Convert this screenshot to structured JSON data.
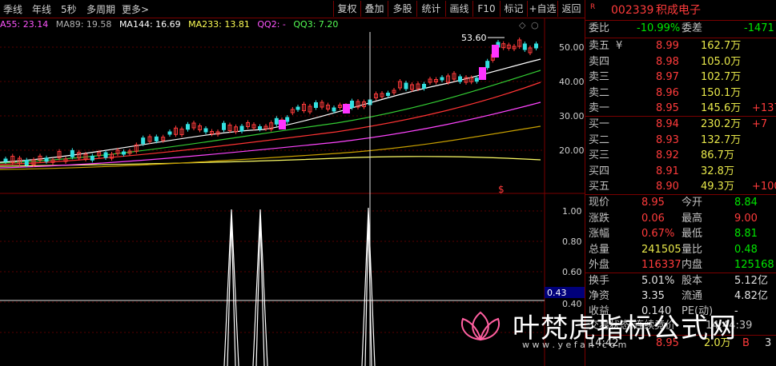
{
  "toolbar": {
    "left_items": [
      "季线",
      "年线",
      "5秒",
      "多周期",
      "更多>"
    ],
    "buttons": [
      "复权",
      "叠加",
      "多股",
      "统计",
      "画线",
      "F10",
      "标记",
      "+自选",
      "返回"
    ]
  },
  "indicators": {
    "ma55": "A55: 23.14",
    "ma89": "MA89: 19.58",
    "ma144": "MA144: 16.69",
    "ma233": "MA233: 13.81",
    "qq2": "QQ2: -",
    "qq3": "QQ3: 7.20",
    "colors": {
      "ma55": "#ff55ff",
      "ma89": "#b0b0b0",
      "ma144": "#ffffff",
      "ma233": "#ffff55",
      "qq2": "#ff55ff",
      "qq3": "#55ff55"
    }
  },
  "main_chart": {
    "peak_label": "53.60",
    "price_ticks": [
      "50.00",
      "40.00",
      "30.00",
      "20.00"
    ],
    "marker": "$"
  },
  "sub_chart": {
    "ticks": [
      "1.00",
      "0.80",
      "0.60",
      "0.40"
    ],
    "cursor_value": "0.43"
  },
  "quote": {
    "code": "002339",
    "name": "积成电子",
    "flag": "R",
    "weibi_label": "委比",
    "weibi": "-10.99%",
    "weicha_label": "委差",
    "weicha": "-1471",
    "sell": [
      {
        "label": "卖五",
        "price": "8.99",
        "vol": "162.7万",
        "extra": ""
      },
      {
        "label": "卖四",
        "price": "8.98",
        "vol": "105.0万",
        "extra": ""
      },
      {
        "label": "卖三",
        "price": "8.97",
        "vol": "102.7万",
        "extra": ""
      },
      {
        "label": "卖二",
        "price": "8.96",
        "vol": "150.1万",
        "extra": ""
      },
      {
        "label": "卖一",
        "price": "8.95",
        "vol": "145.6万",
        "extra": "+137"
      }
    ],
    "sell_mark": "¥",
    "buy": [
      {
        "label": "买一",
        "price": "8.94",
        "vol": "230.2万",
        "extra": "+7"
      },
      {
        "label": "买二",
        "price": "8.93",
        "vol": "132.7万",
        "extra": ""
      },
      {
        "label": "买三",
        "price": "8.92",
        "vol": "86.7万",
        "extra": ""
      },
      {
        "label": "买四",
        "price": "8.91",
        "vol": "32.8万",
        "extra": ""
      },
      {
        "label": "买五",
        "price": "8.90",
        "vol": "49.3万",
        "extra": "+100"
      }
    ],
    "stats": [
      {
        "l1": "现价",
        "v1": "8.95",
        "l2": "今开",
        "v2": "8.84"
      },
      {
        "l1": "涨跌",
        "v1": "0.06",
        "l2": "最高",
        "v2": "9.00"
      },
      {
        "l1": "涨幅",
        "v1": "0.67%",
        "l2": "最低",
        "v2": "8.81"
      },
      {
        "l1": "总量",
        "v1": "241505",
        "l2": "量比",
        "v2": "0.48"
      },
      {
        "l1": "外盘",
        "v1": "116337",
        "l2": "内盘",
        "v2": "125168"
      }
    ],
    "stats2": [
      {
        "l1": "换手",
        "v1": "5.01%",
        "l2": "股本",
        "v2": "5.12亿"
      },
      {
        "l1": "净资",
        "v1": "3.35",
        "l2": "流通",
        "v2": "4.82亿"
      },
      {
        "l1": "收益",
        "v1": "0.140",
        "l2": "PE(动)",
        "v2": "-"
      }
    ],
    "status": "交易状态:连续竞价",
    "status_time": "14:44:39",
    "tick": {
      "time": "14:42",
      "price": "8.95",
      "vol": "2.0万",
      "side": "B",
      "num": "3"
    }
  },
  "watermark": {
    "text": "叶梵虎指标公式网",
    "url": "w w w . y e f a n . c o m"
  }
}
